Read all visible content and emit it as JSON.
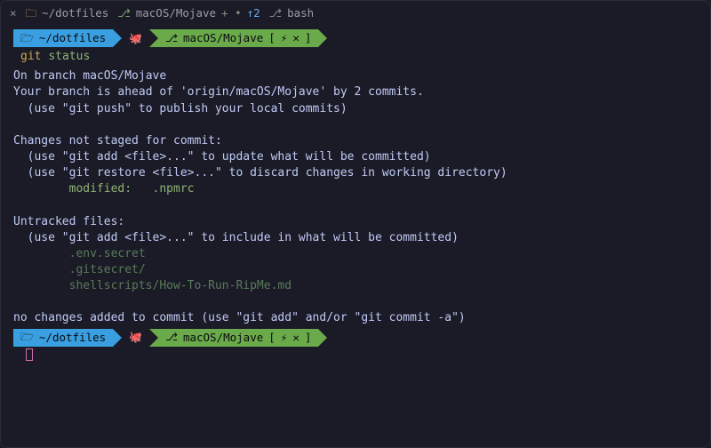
{
  "titlebar": {
    "close_glyph": "×",
    "folder_glyph": "🗀",
    "path": "~/dotfiles",
    "branch_glyph": "⎇",
    "branch": "macOS/Mojave",
    "dirty": "+ •",
    "ahead": "↑2",
    "shell_glyph": "⎇",
    "shell": "bash"
  },
  "prompt": {
    "folder_glyph": "🗁",
    "path": "~/dotfiles",
    "git_glyph": "🐙",
    "branch_glyph": "⎇",
    "branch": "macOS/Mojave",
    "status_left": "[",
    "status_bolt": "⚡",
    "status_x": "✕",
    "status_right": "]"
  },
  "command": {
    "prompt_glyph": "",
    "cmd": "git",
    "sub": "status"
  },
  "output": {
    "line1": "On branch macOS/Mojave",
    "line2": "Your branch is ahead of 'origin/macOS/Mojave' by 2 commits.",
    "line3": "  (use \"git push\" to publish your local commits)",
    "line4": "Changes not staged for commit:",
    "line5": "  (use \"git add <file>...\" to update what will be committed)",
    "line6": "  (use \"git restore <file>...\" to discard changes in working directory)",
    "modified": "        modified:   .npmrc",
    "line7": "Untracked files:",
    "line8": "  (use \"git add <file>...\" to include in what will be committed)",
    "untracked1": "        .env.secret",
    "untracked2": "        .gitsecret/",
    "untracked3": "        shellscripts/How-To-Run-RipMe.md",
    "line9": "no changes added to commit (use \"git add\" and/or \"git commit -a\")"
  }
}
